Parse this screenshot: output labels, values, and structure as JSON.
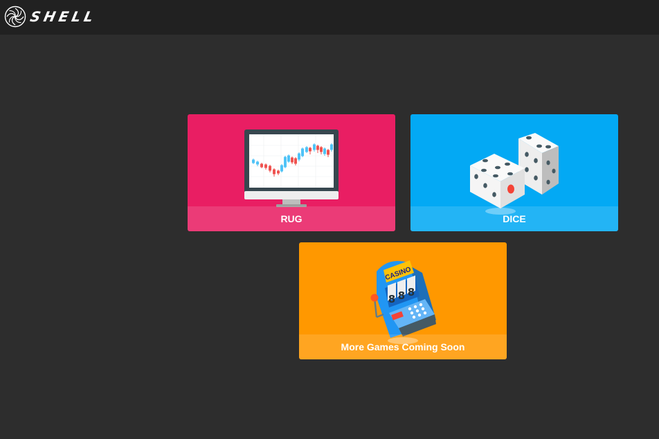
{
  "header": {
    "logo_text": "SHELL",
    "logo_icon": "swirl-logo-icon"
  },
  "games": [
    {
      "label": "RUG",
      "color": "#e91e63",
      "icon": "monitor-candlestick-chart-icon"
    },
    {
      "label": "DICE",
      "color": "#03a9f4",
      "icon": "dice-icon"
    },
    {
      "label": "More Games Coming Soon",
      "color": "#ff9800",
      "icon": "casino-slot-machine-icon",
      "slot_sign": "CASINO",
      "slot_reels": [
        "8",
        "8",
        "8"
      ]
    }
  ],
  "colors": {
    "background": "#2d2d2d",
    "topbar": "#212121"
  }
}
